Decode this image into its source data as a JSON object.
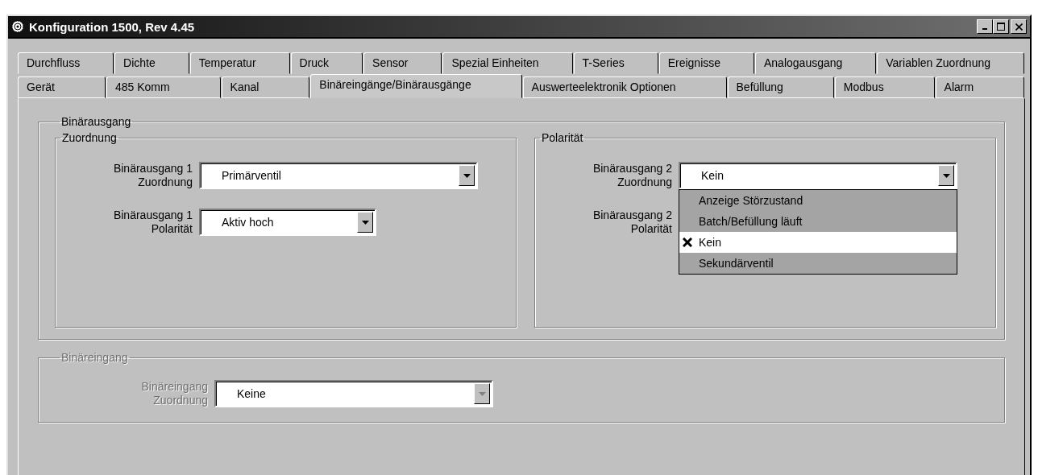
{
  "window": {
    "title": "Konfiguration 1500, Rev 4.45"
  },
  "tab_rows": [
    {
      "tabs": [
        {
          "label": "Durchfluss",
          "selected": false
        },
        {
          "label": "Dichte",
          "selected": false
        },
        {
          "label": "Temperatur",
          "selected": false
        },
        {
          "label": "Druck",
          "selected": false
        },
        {
          "label": "Sensor",
          "selected": false
        },
        {
          "label": "Spezial Einheiten",
          "selected": false
        },
        {
          "label": "T-Series",
          "selected": false
        },
        {
          "label": "Ereignisse",
          "selected": false
        },
        {
          "label": "Analogausgang",
          "selected": false
        },
        {
          "label": "Variablen Zuordnung",
          "selected": false
        }
      ]
    },
    {
      "tabs": [
        {
          "label": "Gerät",
          "selected": false
        },
        {
          "label": "485 Komm",
          "selected": false
        },
        {
          "label": "Kanal",
          "selected": false
        },
        {
          "label": "Binäreingänge/Binärausgänge",
          "selected": true
        },
        {
          "label": "Auswerteelektronik Optionen",
          "selected": false
        },
        {
          "label": "Befüllung",
          "selected": false
        },
        {
          "label": "Modbus",
          "selected": false
        },
        {
          "label": "Alarm",
          "selected": false
        }
      ]
    }
  ],
  "binaerausgang": {
    "title": "Binärausgang",
    "disabled": false,
    "groups": [
      {
        "title": "Zuordnung",
        "fields": [
          {
            "label_1": "Binärausgang 1",
            "label_2": "Zuordnung",
            "value": "Primärventil"
          },
          {
            "label_1": "Binärausgang 1",
            "label_2": "Polarität",
            "value": "Aktiv hoch"
          }
        ]
      },
      {
        "title": "Polarität",
        "fields": [
          {
            "label_1": "Binärausgang 2",
            "label_2": "Zuordnung",
            "value": "Kein",
            "expanded": true,
            "options": [
              {
                "label": "Anzeige Störzustand",
                "selected": false
              },
              {
                "label": "Batch/Befüllung läuft",
                "selected": false
              },
              {
                "label": "Kein",
                "selected": true
              },
              {
                "label": "Sekundärventil",
                "selected": false
              }
            ]
          },
          {
            "label_1": "Binärausgang 2",
            "label_2": "Polarität"
          }
        ]
      }
    ]
  },
  "binaereingang": {
    "title": "Binäreingang",
    "disabled": true,
    "fields": [
      {
        "label_1": "Binäreingang",
        "label_2": "Zuordnung",
        "value": "Keine"
      }
    ]
  }
}
